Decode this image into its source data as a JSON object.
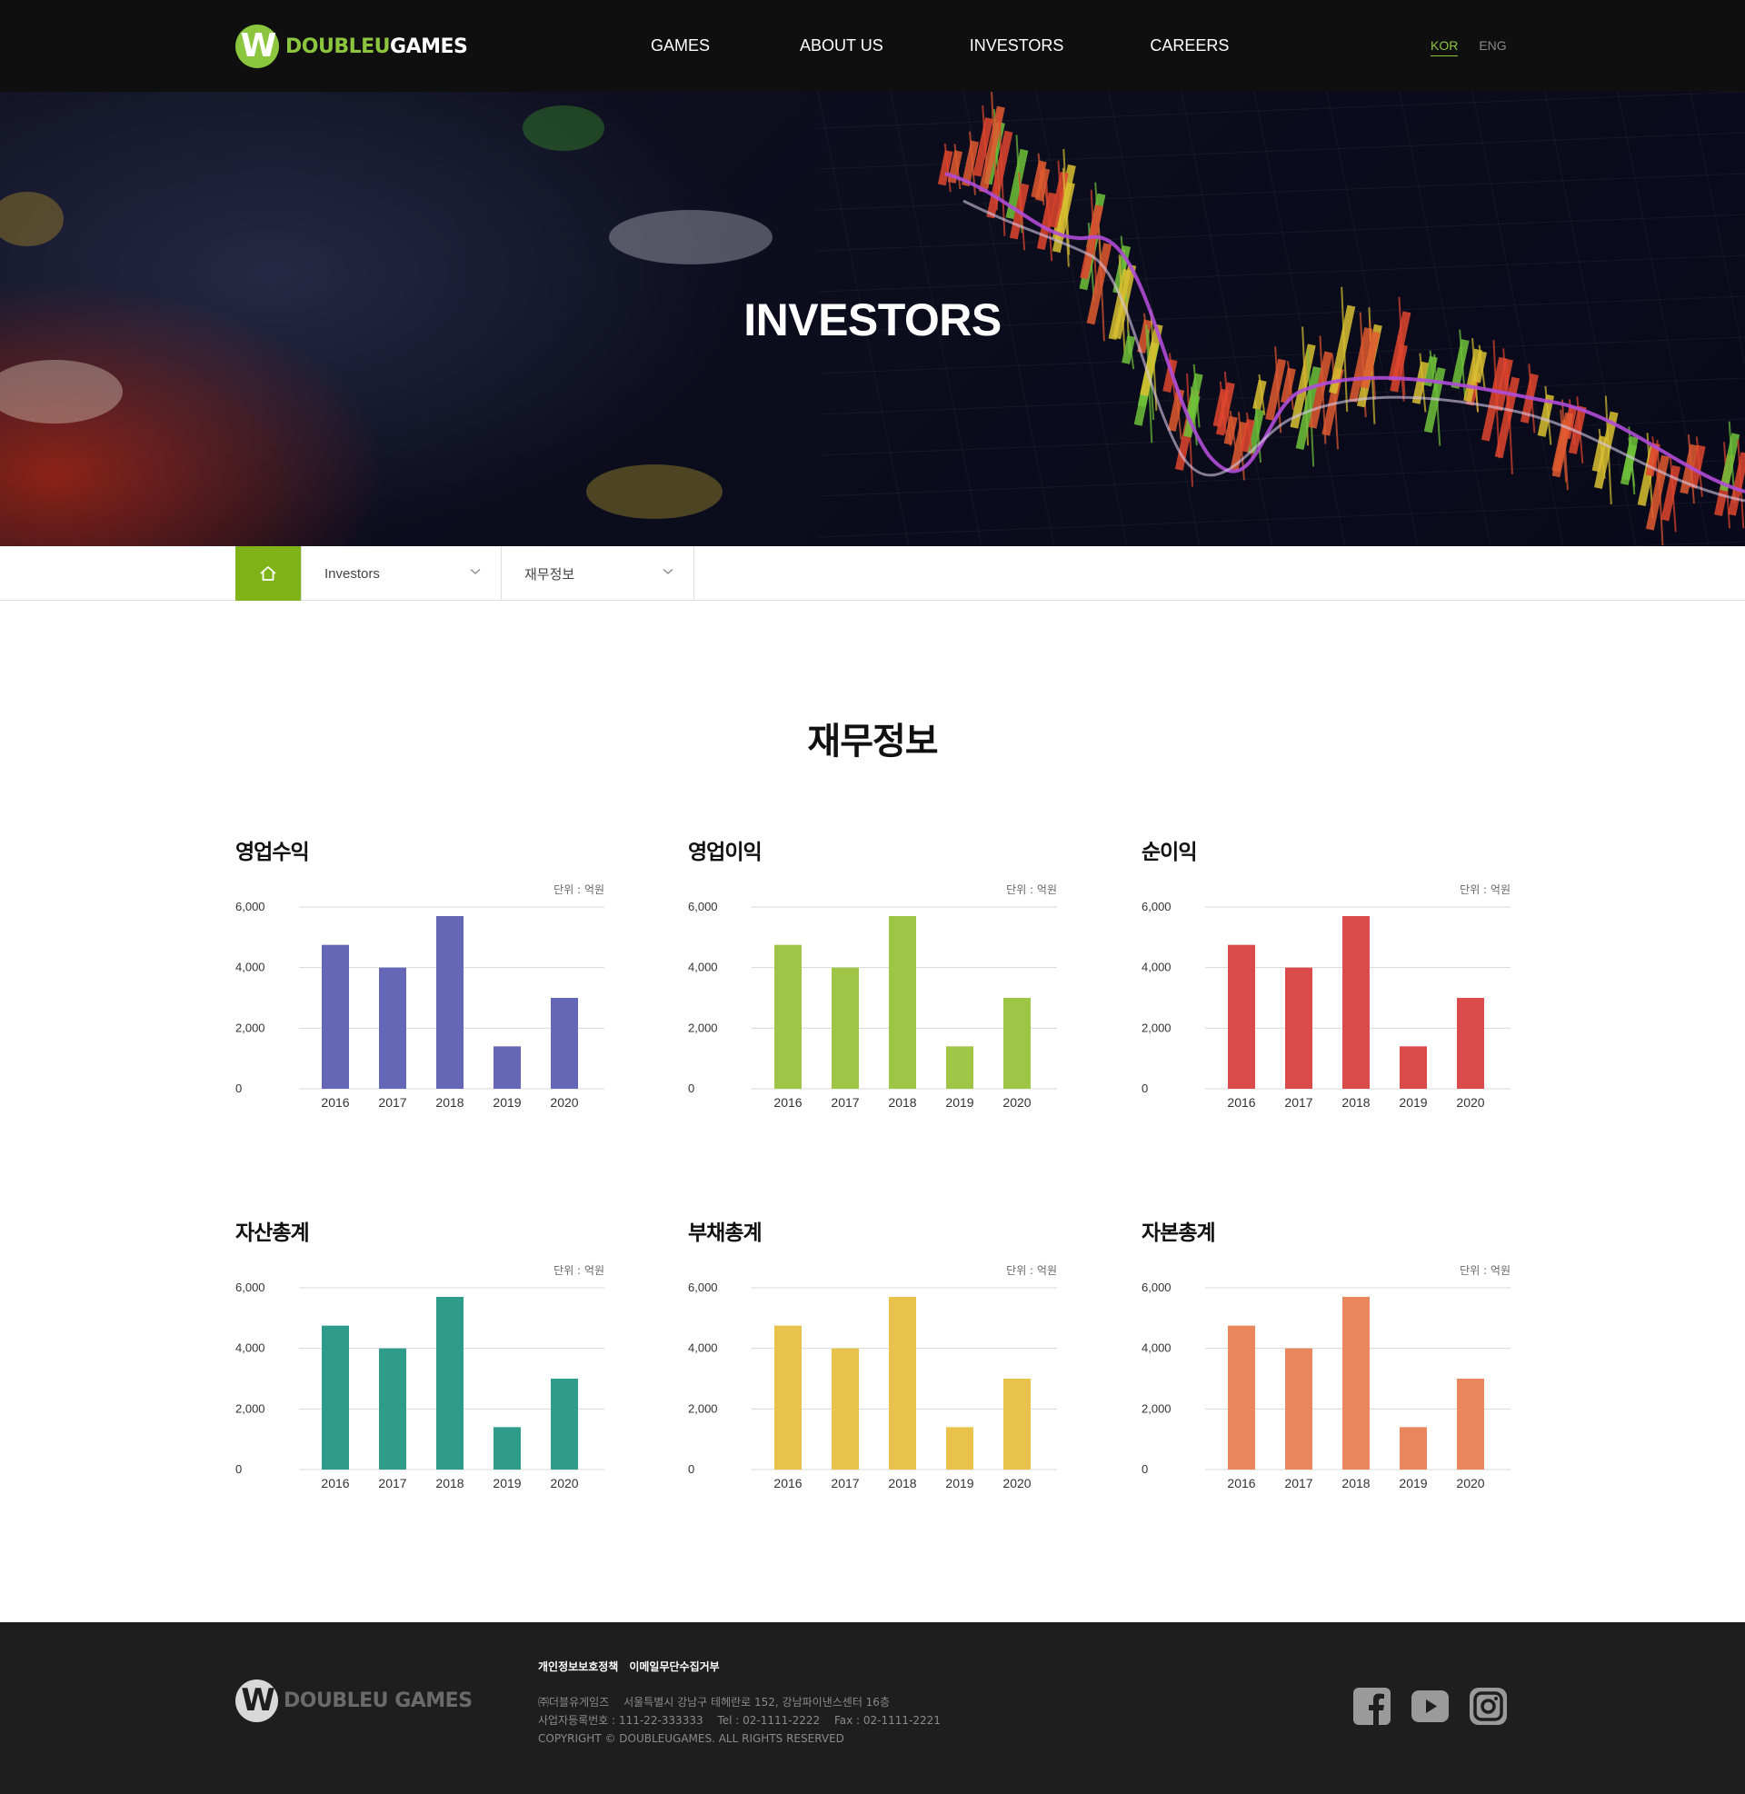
{
  "header": {
    "logo_part1": "DOUBLEU",
    "logo_part2": "GAMES",
    "nav": [
      "GAMES",
      "ABOUT US",
      "INVESTORS",
      "CAREERS"
    ],
    "lang_active": "KOR",
    "lang_other": "ENG",
    "colors": {
      "brand_green": "#8cc63f",
      "header_bg": "#0f0f0f"
    }
  },
  "hero": {
    "title": "INVESTORS"
  },
  "breadcrumb": {
    "home_icon": "home-icon",
    "level1": "Investors",
    "level2": "재무정보"
  },
  "main": {
    "title": "재무정보",
    "unit_label": "단위 : 억원"
  },
  "chart_data": [
    {
      "type": "bar",
      "title": "영업수익",
      "color": "#6466b6",
      "categories": [
        "2016",
        "2017",
        "2018",
        "2019",
        "2020"
      ],
      "values": [
        4750,
        4000,
        5700,
        1400,
        3000
      ],
      "ylim": [
        0,
        6000
      ],
      "yticks": [
        "0",
        "2,000",
        "4,000",
        "6,000"
      ],
      "ylabel": "단위 : 억원",
      "grid": true
    },
    {
      "type": "bar",
      "title": "영업이익",
      "color": "#9ec545",
      "categories": [
        "2016",
        "2017",
        "2018",
        "2019",
        "2020"
      ],
      "values": [
        4750,
        4000,
        5700,
        1400,
        3000
      ],
      "ylim": [
        0,
        6000
      ],
      "yticks": [
        "0",
        "2,000",
        "4,000",
        "6,000"
      ],
      "ylabel": "단위 : 억원",
      "grid": true
    },
    {
      "type": "bar",
      "title": "순이익",
      "color": "#dc4b4c",
      "categories": [
        "2016",
        "2017",
        "2018",
        "2019",
        "2020"
      ],
      "values": [
        4750,
        4000,
        5700,
        1400,
        3000
      ],
      "ylim": [
        0,
        6000
      ],
      "yticks": [
        "0",
        "2,000",
        "4,000",
        "6,000"
      ],
      "ylabel": "단위 : 억원",
      "grid": true
    },
    {
      "type": "bar",
      "title": "자산총계",
      "color": "#2e9b8b",
      "categories": [
        "2016",
        "2017",
        "2018",
        "2019",
        "2020"
      ],
      "values": [
        4750,
        4000,
        5700,
        1400,
        3000
      ],
      "ylim": [
        0,
        6000
      ],
      "yticks": [
        "0",
        "2,000",
        "4,000",
        "6,000"
      ],
      "ylabel": "단위 : 억원",
      "grid": true
    },
    {
      "type": "bar",
      "title": "부채총계",
      "color": "#e8c24a",
      "categories": [
        "2016",
        "2017",
        "2018",
        "2019",
        "2020"
      ],
      "values": [
        4750,
        4000,
        5700,
        1400,
        3000
      ],
      "ylim": [
        0,
        6000
      ],
      "yticks": [
        "0",
        "2,000",
        "4,000",
        "6,000"
      ],
      "ylabel": "단위 : 억원",
      "grid": true
    },
    {
      "type": "bar",
      "title": "자본총계",
      "color": "#e9865b",
      "categories": [
        "2016",
        "2017",
        "2018",
        "2019",
        "2020"
      ],
      "values": [
        4750,
        4000,
        5700,
        1400,
        3000
      ],
      "ylim": [
        0,
        6000
      ],
      "yticks": [
        "0",
        "2,000",
        "4,000",
        "6,000"
      ],
      "ylabel": "단위 : 억원",
      "grid": true
    }
  ],
  "footer": {
    "logo_part1": "DOUBLEU",
    "logo_part2": "GAMES",
    "links": [
      "개인정보보호정책",
      "이메일무단수집거부"
    ],
    "company": "㈜더블유게임즈",
    "address": "서울특별시 강남구 테헤란로 152, 강남파이낸스센터 16층",
    "business_no": "사업자등록번호 : 111-22-333333",
    "tel": "Tel : 02-1111-2222",
    "fax": "Fax : 02-1111-2221",
    "copyright": "COPYRIGHT © DOUBLEUGAMES. ALL RIGHTS RESERVED",
    "social": [
      "facebook-icon",
      "youtube-icon",
      "instagram-icon"
    ]
  }
}
